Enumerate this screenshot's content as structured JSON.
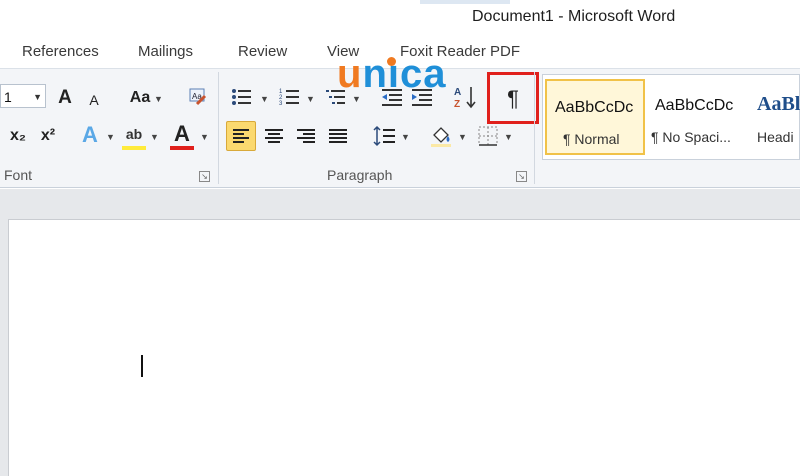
{
  "window": {
    "title": "Document1  -  Microsoft Word"
  },
  "tabs": [
    {
      "label": "References"
    },
    {
      "label": "Mailings"
    },
    {
      "label": "Review"
    },
    {
      "label": "View"
    },
    {
      "label": "Foxit Reader PDF"
    }
  ],
  "watermark": {
    "orange_u": "u",
    "blue_n": "n",
    "blue_i": "ı",
    "blue_c": "c",
    "blue_a": "a"
  },
  "font_group": {
    "label": "Font",
    "font_size": "1",
    "grow_label": "A",
    "shrink_label": "A",
    "case_label": "Aa",
    "subscript_label": "x₂",
    "superscript_label": "x²",
    "text_effects_label": "A",
    "highlight_label": "ab",
    "font_color_label": "A"
  },
  "paragraph_group": {
    "label": "Paragraph",
    "show_hide_label": "¶"
  },
  "styles": [
    {
      "preview": "AaBbCcDc",
      "name": "¶ Normal"
    },
    {
      "preview": "AaBbCcDc",
      "name": "¶ No Spaci..."
    },
    {
      "preview": "AaBl",
      "name": "Headi"
    }
  ],
  "colors": {
    "highlight_marker": "#e0201c",
    "watermark_orange": "#f07a21",
    "watermark_blue": "#1f8fd8",
    "active_button": "#fbd96f"
  }
}
